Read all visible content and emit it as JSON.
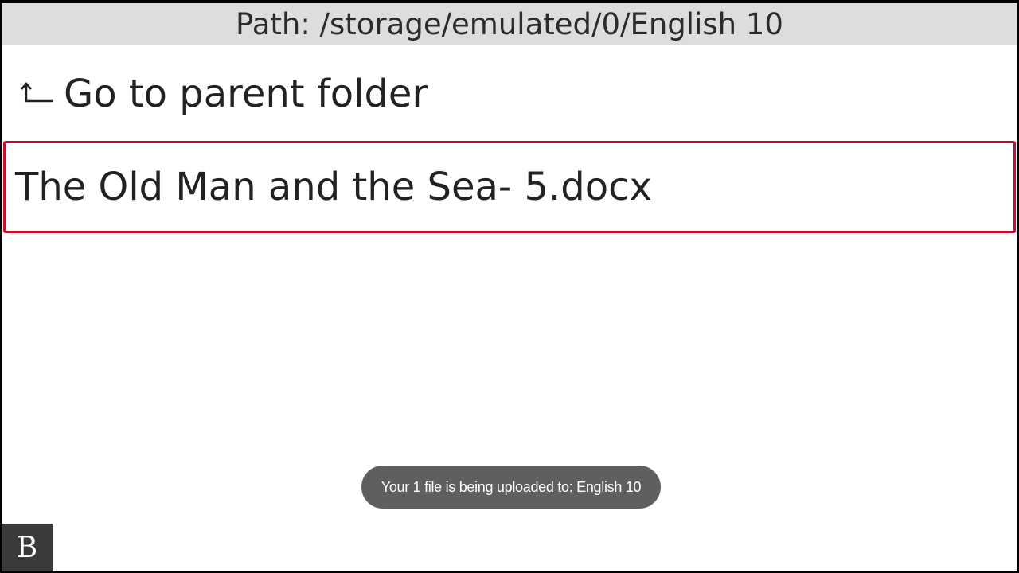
{
  "header": {
    "path_label": "Path: /storage/emulated/0/English 10"
  },
  "navigation": {
    "parent_folder_label": "Go to parent folder",
    "parent_folder_icon": "return-arrow-icon"
  },
  "file_list": {
    "items": [
      {
        "name": "The Old Man and the Sea- 5.docx"
      }
    ],
    "selected_border_color": "#c8102e"
  },
  "toast": {
    "message": "Your 1 file is being uploaded to: English 10"
  },
  "badge": {
    "letter": "B"
  }
}
